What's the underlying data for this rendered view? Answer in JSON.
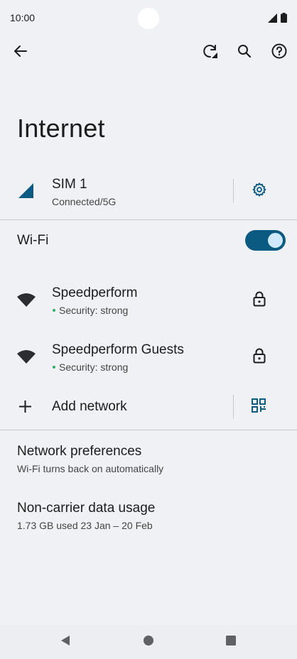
{
  "status_bar": {
    "time": "10:00"
  },
  "page": {
    "title": "Internet"
  },
  "sim": {
    "name": "SIM 1",
    "status": "Connected/5G"
  },
  "wifi": {
    "label": "Wi-Fi",
    "enabled": true
  },
  "networks": [
    {
      "name": "Speedperform",
      "security": "Security: strong"
    },
    {
      "name": "Speedperform Guests",
      "security": "Security: strong"
    }
  ],
  "add_network": {
    "label": "Add network"
  },
  "preferences": [
    {
      "title": "Network preferences",
      "subtitle": "Wi-Fi turns back on automatically"
    },
    {
      "title": "Non-carrier data usage",
      "subtitle": "1.73 GB used 23 Jan – 20 Feb"
    }
  ],
  "colors": {
    "accent": "#0b5a82",
    "background": "#eff1f4",
    "security_dot": "#35a86a"
  }
}
